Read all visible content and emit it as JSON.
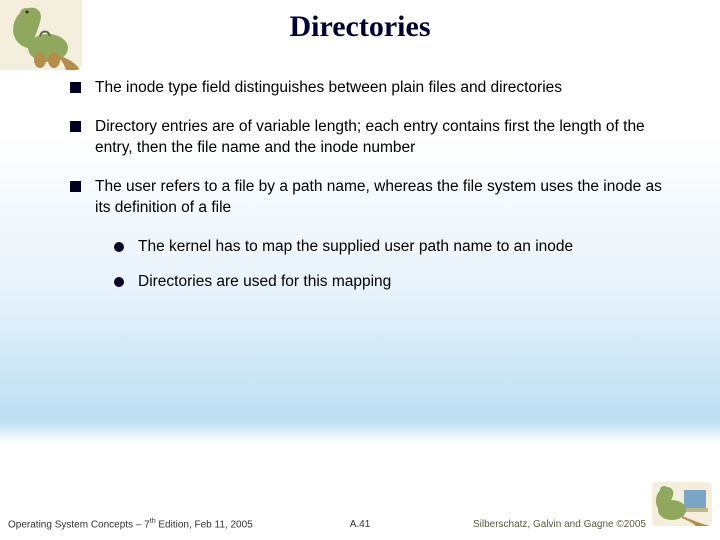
{
  "title": "Directories",
  "bullets": [
    "The inode type field distinguishes between plain files and directories",
    "Directory entries are of variable length; each entry contains first the length of the entry, then the file name and the inode number",
    "The user refers to a file by a path name, whereas the file system uses the inode as its definition of a file"
  ],
  "subbullets": [
    "The kernel has to map the supplied user path name to an inode",
    "Directories are used for this mapping"
  ],
  "footer": {
    "left_prefix": "Operating System Concepts – 7",
    "left_ordinal": "th",
    "left_suffix": " Edition, Feb 11, 2005",
    "center": "A.41",
    "right": "Silberschatz, Galvin and Gagne ©2005"
  }
}
